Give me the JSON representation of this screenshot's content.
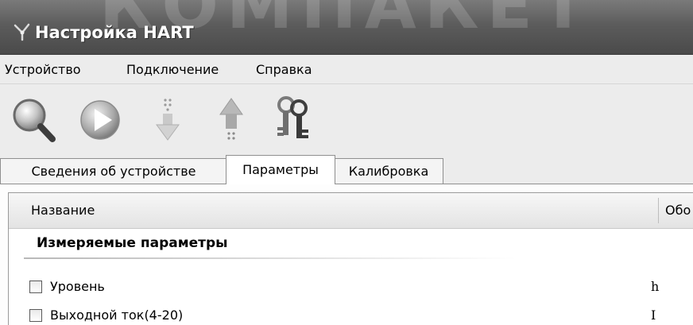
{
  "window": {
    "title": "Настройка HART",
    "watermark": "КОМПАКЕТ"
  },
  "menu": {
    "items": [
      "Устройство",
      "Подключение",
      "Справка"
    ]
  },
  "toolbar": {
    "buttons": [
      "search-icon",
      "play-icon",
      "download-icon",
      "upload-icon",
      "keys-icon"
    ]
  },
  "tabs": {
    "items": [
      "Сведения об устройстве",
      "Параметры",
      "Калибровка"
    ],
    "active": "Параметры"
  },
  "table": {
    "columns": [
      "Название",
      "Обо"
    ],
    "group_title": "Измеряемые параметры",
    "rows": [
      {
        "label": "Уровень",
        "symbol": "h",
        "checked": false
      },
      {
        "label": "Выходной ток(4-20)",
        "symbol": "I",
        "checked": false
      }
    ]
  }
}
